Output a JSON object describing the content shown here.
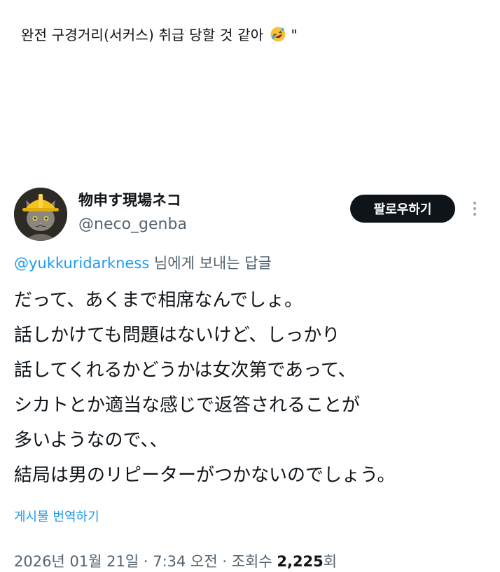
{
  "caption": {
    "text": "완전 구경거리(서커스) 취급 당할 것 같아",
    "emoji": "rolling-on-floor-laughing-emoji",
    "trailing": "\""
  },
  "tweet": {
    "author": {
      "name": "物申す現場ネコ",
      "handle": "@neco_genba",
      "avatar": "cat-with-hard-hat-avatar"
    },
    "follow_label": "팔로우하기",
    "more_icon": "more-vertical-icon",
    "reply": {
      "mention": "@yukkuridarkness",
      "suffix": " 님에게 보내는 답글"
    },
    "lines": [
      "だって、あくまで相席なんでしょ。",
      "話しかけても問題はないけど、しっかり",
      "話してくれるかどうかは女次第であって、",
      "シカトとか適当な感じで返答されることが",
      "多いようなので、、",
      "結局は男のリピーターがつかないのでしょう。"
    ],
    "translate_label": "게시물 번역하기",
    "timestamp": "2026년 01월 21일 · 7:34 오전 · 조회수 ",
    "views": "2,225",
    "views_suffix": "회"
  },
  "colors": {
    "text": "#0f1419",
    "secondary": "#536471",
    "link": "#1d9bf0",
    "button_bg": "#0f1419",
    "button_text": "#ffffff"
  }
}
